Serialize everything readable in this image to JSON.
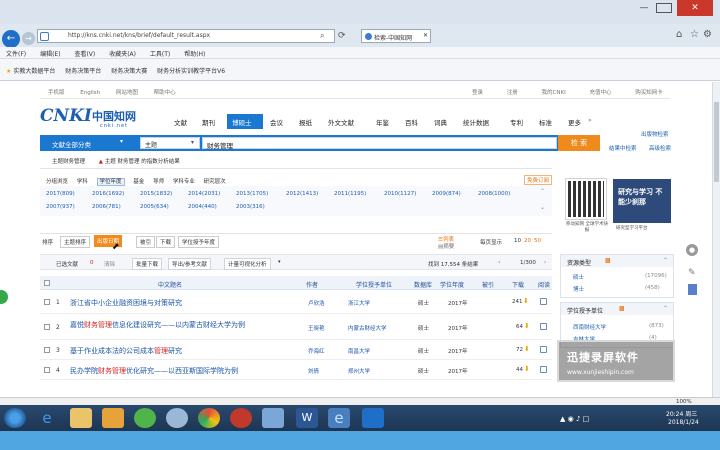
{
  "browser": {
    "address": "http://kns.cnki.net/kns/brief/default_result.aspx",
    "tab_title": "检索-中国知网",
    "menu": [
      "文件(F)",
      "编辑(E)",
      "查看(V)",
      "收藏夹(A)",
      "工具(T)",
      "帮助(H)"
    ],
    "favorites": [
      "实教大数据平台",
      "财务决策平台",
      "财务决策大赛",
      "财务分析实训教学平台V6"
    ],
    "zoom": "100%"
  },
  "topnav": {
    "left": [
      "手机版",
      "English",
      "网站地图",
      "帮助中心"
    ],
    "right": [
      "登录",
      "注册",
      "我的CNKI",
      "充值中心",
      "购买知网卡"
    ]
  },
  "logo": {
    "main": "CNKI",
    "cn": "中国知网",
    "sub": "cnki.net"
  },
  "main_tabs": [
    "文献",
    "期刊",
    "博硕士",
    "会议",
    "报纸",
    "外文文献",
    "年鉴",
    "百科",
    "词典",
    "统计数据",
    "专利",
    "标准",
    "更多"
  ],
  "active_tab": "博硕士",
  "search": {
    "category": "文献全部分类",
    "field": "主题",
    "query": "财务管理",
    "button": "检 索"
  },
  "right_links": {
    "a": "出版物检索",
    "b": "结果中检索",
    "c": "高级检索"
  },
  "subnav": {
    "item1": "主题财务管理",
    "item2": "主题 财务管理 的指数分析结果"
  },
  "group_tabs": [
    "分组浏览",
    "学科",
    "学位年度",
    "基金",
    "导师",
    "学科专业",
    "研究层次"
  ],
  "group_right": "免费订阅",
  "year_rows": [
    [
      "2017(809)",
      "2016(1692)",
      "2015(1832)",
      "2014(2031)",
      "2013(1705)",
      "2012(1413)",
      "2011(1195)",
      "2010(1127)",
      "2009(874)",
      "2008(1000)"
    ],
    [
      "2007(937)",
      "2006(781)",
      "2005(634)",
      "2004(440)",
      "2003(316)"
    ]
  ],
  "sort": {
    "label": "排序",
    "items": [
      "主题排序",
      "出版日期",
      "被引",
      "下载",
      "学位授予年度"
    ],
    "active": "出版日期"
  },
  "view": {
    "list": "列表",
    "abstract": "摘要",
    "per_page_label": "每页显示",
    "per_page": [
      "10",
      "20",
      "50"
    ]
  },
  "action_bar": {
    "selected": "已选文献",
    "selected_count": "0",
    "clear": "清除",
    "batch": "批量下载",
    "export": "导出/参考文献",
    "visual": "计量可视化分析",
    "found": "找到 17,554 条结果",
    "page": "1/300"
  },
  "table_header": [
    "中文题名",
    "作者",
    "学位授予单位",
    "数据库",
    "学位年度",
    "被引",
    "下载",
    "阅读"
  ],
  "rows": [
    {
      "num": "1",
      "title_a": "浙江省中小企业融资困境与对策研究",
      "title_b": "",
      "author": "卢欣浩",
      "school": "浙江大学",
      "db": "硕士",
      "year": "2017年",
      "cite": "",
      "dl": "241"
    },
    {
      "num": "2",
      "title_a": "嘉悦",
      "hl": "财务管理",
      "title_b": "信息化建设研究——以内蒙古财经大学为例",
      "author": "王晓艳",
      "school": "内蒙古财经大学",
      "db": "硕士",
      "year": "2017年",
      "cite": "",
      "dl": "64"
    },
    {
      "num": "3",
      "title_a": "基于作业成本法的公司成本",
      "hl": "管理",
      "title_b": "研究",
      "author": "乔海红",
      "school": "南昌大学",
      "db": "硕士",
      "year": "2017年",
      "cite": "",
      "dl": "72"
    },
    {
      "num": "4",
      "title_a": "民办学院",
      "hl": "财务管理",
      "title_b": "优化研究——以西亚斯国际学院为例",
      "author": "刘倩",
      "school": "郑州大学",
      "db": "硕士",
      "year": "2017年",
      "cite": "",
      "dl": "44"
    }
  ],
  "sidebar": {
    "qr_text": "移动知网 全球学术快报",
    "promo_title": "研究与学习 不能少刹那",
    "promo_caption": "研究型学习平台",
    "type_title": "资源类型",
    "types": [
      {
        "name": "硕士",
        "count": "(17096)"
      },
      {
        "name": "博士",
        "count": "(458)"
      }
    ],
    "unit_title": "学位授予单位",
    "units": [
      {
        "name": "西南财经大学",
        "count": "(873)"
      },
      {
        "name": "吉林大学",
        "count": "(4)"
      }
    ]
  },
  "watermark": {
    "line1": "迅捷录屏软件",
    "line2": "www.xunjieshipin.com"
  },
  "clock": {
    "time": "20:24 周三",
    "date": "2018/1/24"
  }
}
